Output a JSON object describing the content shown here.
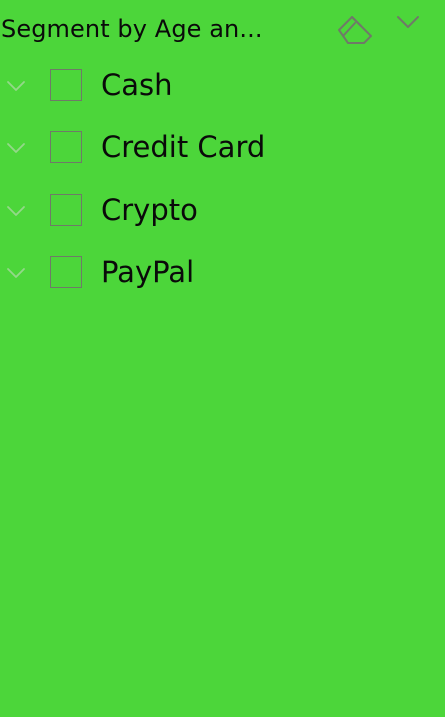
{
  "slicer": {
    "title": "Segment by Age an...",
    "header_icons": {
      "clear": "eraser-icon",
      "collapse": "chevron-down-icon"
    },
    "items": [
      {
        "label": "Cash",
        "checked": false
      },
      {
        "label": "Credit Card",
        "checked": false
      },
      {
        "label": "Crypto",
        "checked": false
      },
      {
        "label": "PayPal",
        "checked": false
      }
    ]
  },
  "colors": {
    "background": "#4cd63a",
    "text": "#0a0a0a",
    "icon_stroke": "#6f7a68",
    "expand_chevron": "#94d88a"
  }
}
